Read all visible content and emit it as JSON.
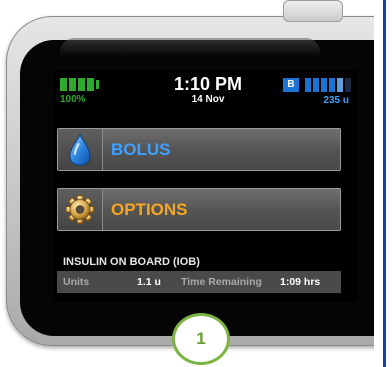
{
  "status": {
    "battery_percent": "100%",
    "battery_level": 1.0,
    "time": "1:10 PM",
    "date": "14 Nov",
    "bolus_badge": "B",
    "insulin_units": "235 u",
    "reservoir_level": 0.85
  },
  "menu": {
    "bolus_label": "BOLUS",
    "options_label": "OPTIONS",
    "bolus_icon": "insulin-drop-icon",
    "options_icon": "gear-icon"
  },
  "iob": {
    "title": "INSULIN ON BOARD (IOB)",
    "units_label": "Units",
    "units_value": "1.1 u",
    "time_label": "Time Remaining",
    "time_value": "1:09 hrs"
  },
  "callout": {
    "number": "1"
  },
  "colors": {
    "battery_green": "#2eaa2e",
    "accent_blue": "#3ea0ff",
    "accent_orange": "#f5a623",
    "callout_green": "#7cb342",
    "screen_bg": "#000000"
  }
}
